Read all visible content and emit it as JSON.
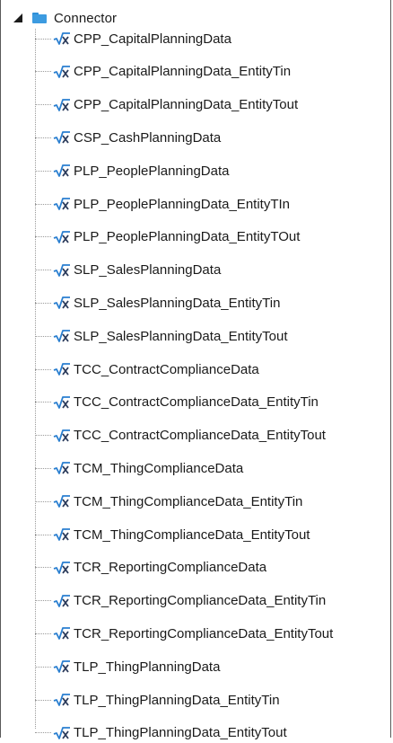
{
  "tree": {
    "root": {
      "label": "Connector",
      "icon": "folder-icon",
      "expanded": true
    },
    "item_icon": "function-icon",
    "items": [
      {
        "label": "CPP_CapitalPlanningData"
      },
      {
        "label": "CPP_CapitalPlanningData_EntityTin"
      },
      {
        "label": "CPP_CapitalPlanningData_EntityTout"
      },
      {
        "label": "CSP_CashPlanningData"
      },
      {
        "label": "PLP_PeoplePlanningData"
      },
      {
        "label": "PLP_PeoplePlanningData_EntityTIn"
      },
      {
        "label": "PLP_PeoplePlanningData_EntityTOut"
      },
      {
        "label": "SLP_SalesPlanningData"
      },
      {
        "label": "SLP_SalesPlanningData_EntityTin"
      },
      {
        "label": "SLP_SalesPlanningData_EntityTout"
      },
      {
        "label": "TCC_ContractComplianceData"
      },
      {
        "label": "TCC_ContractComplianceData_EntityTin"
      },
      {
        "label": "TCC_ContractComplianceData_EntityTout"
      },
      {
        "label": "TCM_ThingComplianceData"
      },
      {
        "label": "TCM_ThingComplianceData_EntityTin"
      },
      {
        "label": "TCM_ThingComplianceData_EntityTout"
      },
      {
        "label": "TCR_ReportingComplianceData"
      },
      {
        "label": "TCR_ReportingComplianceData_EntityTin"
      },
      {
        "label": "TCR_ReportingComplianceData_EntityTout"
      },
      {
        "label": "TLP_ThingPlanningData"
      },
      {
        "label": "TLP_ThingPlanningData_EntityTin"
      },
      {
        "label": "TLP_ThingPlanningData_EntityTout"
      }
    ]
  },
  "colors": {
    "folder": "#3c9be0",
    "function_icon": "#2a7fd0",
    "text": "#1a1a1a",
    "connector_line": "#9a9a9a"
  }
}
